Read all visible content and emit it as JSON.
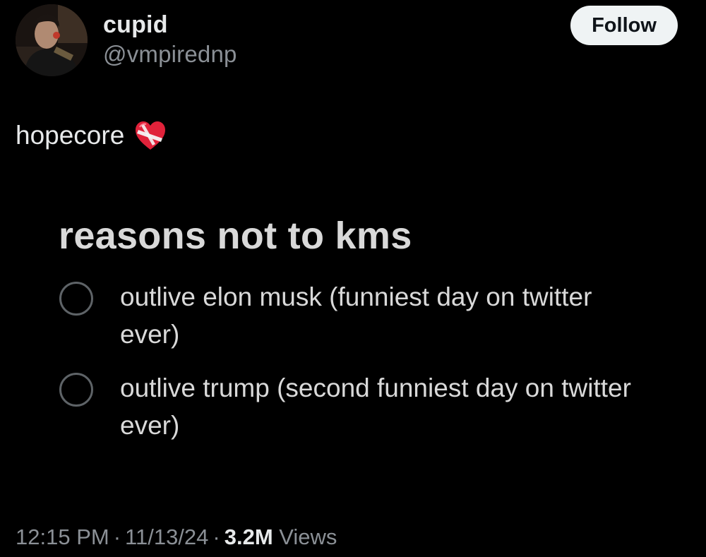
{
  "author": {
    "display_name": "cupid",
    "handle": "@vmpirednp",
    "avatar_icon": "profile-photo"
  },
  "follow_button": {
    "label": "Follow"
  },
  "tweet": {
    "text": "hopecore",
    "emoji_icon": "mending-heart-icon"
  },
  "poll": {
    "title": "reasons not to kms",
    "options": [
      {
        "label": "outlive elon musk (funniest day on twitter ever)"
      },
      {
        "label": "outlive trump (second funniest day on twitter ever)"
      }
    ]
  },
  "meta": {
    "time": "12:15 PM",
    "date": "11/13/24",
    "views_count": "3.2M",
    "views_label": "Views",
    "separator": "·"
  },
  "colors": {
    "background": "#000000",
    "primary_text": "#e7e9ea",
    "secondary_text": "#8b9096",
    "follow_bg": "#eff3f4",
    "heart_red": "#e0223a"
  }
}
